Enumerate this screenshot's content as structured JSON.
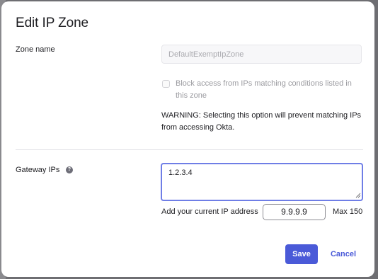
{
  "modal": {
    "title": "Edit IP Zone"
  },
  "zone_name": {
    "label": "Zone name",
    "value": "DefaultExemptIpZone"
  },
  "block_access": {
    "checked": false,
    "label": "Block access from IPs matching conditions listed in this zone"
  },
  "warning": {
    "text": "WARNING: Selecting this option will prevent matching IPs from accessing Okta."
  },
  "gateway_ips": {
    "label": "Gateway IPs",
    "help_icon": "question-circle-icon",
    "value": "1.2.3.4",
    "add_current_label": "Add your current IP address",
    "current_ip": "9.9.9.9",
    "max_label": "Max 150"
  },
  "buttons": {
    "save": "Save",
    "cancel": "Cancel"
  },
  "colors": {
    "accent": "#4a5ad8",
    "focus_border": "#6f7ee6",
    "backdrop": "#6e6e72"
  }
}
